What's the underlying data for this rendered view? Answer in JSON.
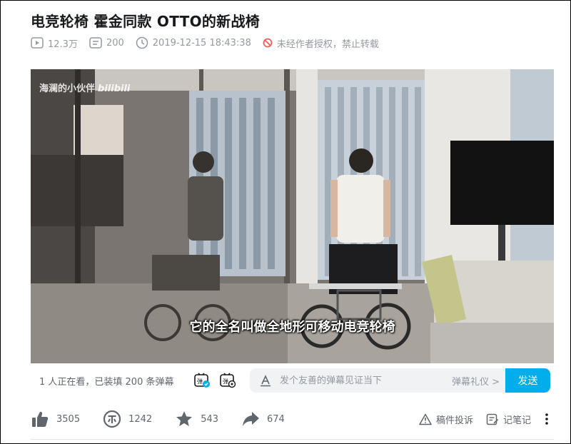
{
  "video": {
    "title": "电竞轮椅 霍金同款 OTTO的新战椅",
    "views": "12.3万",
    "danmaku_count": "200",
    "publish_time": "2019-12-15 18:43:38",
    "copyright_notice": "未经作者授权，禁止转载",
    "watermark_user": "海澜的小伙伴",
    "watermark_logo": "bilibili",
    "subtitle": "它的全名叫做全地形可移动电竞轮椅"
  },
  "danmaku_bar": {
    "watching_text": "1 人正在看，已装填 200 条弹幕",
    "input_placeholder": "发个友善的弹幕见证当下",
    "etiquette_label": "弹幕礼仪 >",
    "send_label": "发送"
  },
  "actions": {
    "like_count": "3505",
    "coin_count": "1242",
    "fav_count": "543",
    "share_count": "674",
    "report_label": "稿件投诉",
    "note_label": "记笔记"
  },
  "colors": {
    "accent": "#00aeec",
    "icon": "#61666d",
    "warning": "#f25d59"
  },
  "icons": {
    "views": "play-icon",
    "danmaku": "danmaku-icon",
    "time": "clock-icon",
    "no_repost": "forbidden-icon",
    "like": "thumbs-up-icon",
    "coin": "coin-icon",
    "fav": "star-icon",
    "share": "share-arrow-icon",
    "report": "warning-triangle-icon",
    "note": "note-icon",
    "more": "more-vertical-icon"
  }
}
